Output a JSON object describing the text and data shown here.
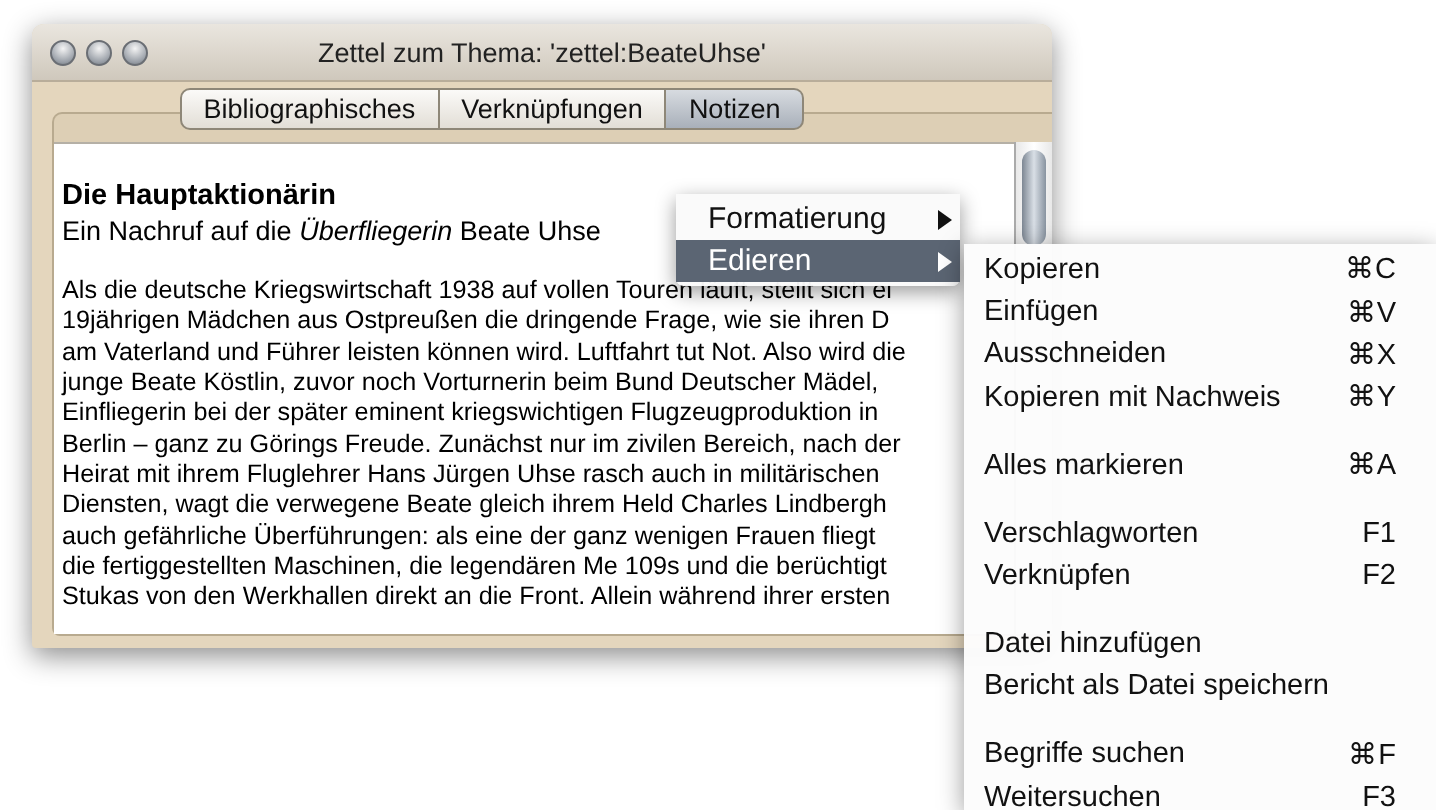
{
  "window": {
    "title": "Zettel zum Thema: 'zettel:BeateUhse'",
    "tabs": [
      {
        "label": "Bibliographisches",
        "selected": false
      },
      {
        "label": "Verknüpfungen",
        "selected": false
      },
      {
        "label": "Notizen",
        "selected": true
      }
    ],
    "note": {
      "heading": "Die Hauptaktionärin",
      "subtitle": "Ein Nachruf auf die *Überfliegerin* Beate Uhse",
      "lines": [
        "Als die deutsche Kriegswirtschaft 1938 auf vollen Touren läuft, stellt sich ei",
        "19jährigen Mädchen aus Ostpreußen die dringende Frage, wie sie ihren D",
        "am Vaterland und Führer leisten können wird. Luftfahrt tut Not. Also wird die",
        "junge Beate Köstlin, zuvor noch Vorturnerin beim Bund Deutscher Mädel,",
        "Einfliegerin bei der später eminent kriegswichtigen Flugzeugproduktion in",
        "Berlin – ganz zu Görings Freude. Zunächst nur im zivilen Bereich, nach der",
        "Heirat mit ihrem Fluglehrer Hans Jürgen Uhse rasch auch in militärischen",
        "Diensten, wagt die verwegene Beate gleich ihrem Held Charles Lindbergh",
        "auch gefährliche Überführungen: als eine der ganz wenigen Frauen fliegt",
        "die fertiggestellten Maschinen, die legendären Me 109s und die berüchtigt",
        "Stukas von den Werkhallen direkt an die Front. Allein während ihrer ersten"
      ]
    }
  },
  "context_menu": {
    "items": [
      {
        "label": "Formatierung",
        "selected": false,
        "has_submenu": true
      },
      {
        "label": "Edieren",
        "selected": true,
        "has_submenu": true
      }
    ]
  },
  "submenu": {
    "items": [
      {
        "kind": "item",
        "label": "Kopieren",
        "shortcut": "⌘C"
      },
      {
        "kind": "item",
        "label": "Einfügen",
        "shortcut": "⌘V"
      },
      {
        "kind": "item",
        "label": "Ausschneiden",
        "shortcut": "⌘X"
      },
      {
        "kind": "item",
        "label": "Kopieren mit Nachweis",
        "shortcut": "⌘Y"
      },
      {
        "kind": "separator"
      },
      {
        "kind": "item",
        "label": "Alles markieren",
        "shortcut": "⌘A"
      },
      {
        "kind": "separator"
      },
      {
        "kind": "item",
        "label": "Verschlagworten",
        "shortcut": "F1"
      },
      {
        "kind": "item",
        "label": "Verknüpfen",
        "shortcut": "F2"
      },
      {
        "kind": "separator"
      },
      {
        "kind": "item",
        "label": "Datei hinzufügen"
      },
      {
        "kind": "item",
        "label": "Bericht als Datei speichern"
      },
      {
        "kind": "separator"
      },
      {
        "kind": "item",
        "label": "Begriffe suchen",
        "shortcut": "⌘F"
      },
      {
        "kind": "item",
        "label": "Weitersuchen",
        "shortcut": "F3"
      }
    ]
  }
}
